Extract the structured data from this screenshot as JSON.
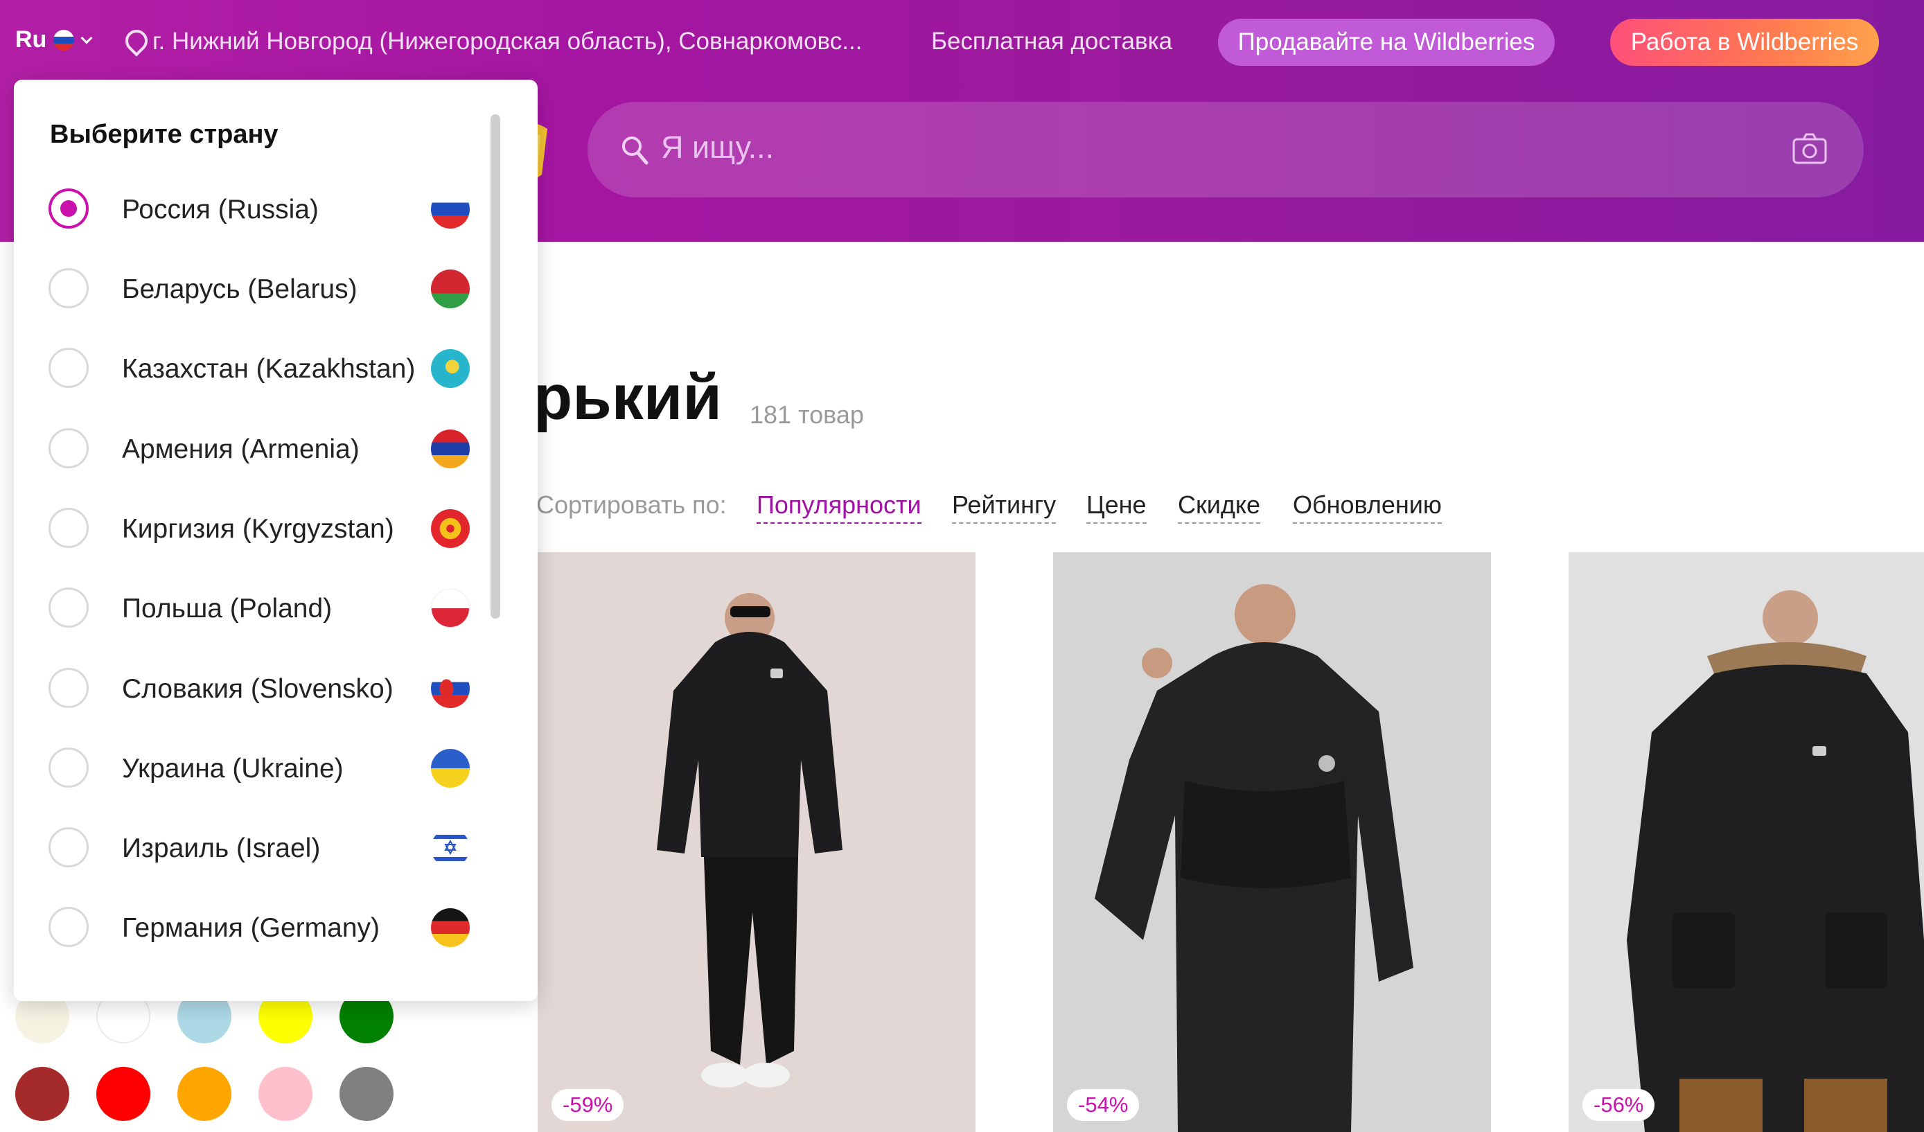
{
  "top_bar": {
    "lang": "Ru",
    "location": "г. Нижний Новгород (Нижегородская область), Совнаркомовс...",
    "delivery": "Бесплатная доставка",
    "sell_button": "Продавайте на Wildberries",
    "job_button": "Работа в Wildberries"
  },
  "search": {
    "placeholder": "Я ищу..."
  },
  "catalog": {
    "title": "рький",
    "count": "181 товар",
    "sort_label": "Сортировать по:",
    "sort_options": [
      "Популярности",
      "Рейтингу",
      "Цене",
      "Скидке",
      "Обновлению"
    ],
    "active_sort": "Популярности",
    "products": [
      {
        "discount": "-59%",
        "background": "#e2d7d4"
      },
      {
        "discount": "-54%",
        "background": "#d5d5d5"
      },
      {
        "discount": "-56%",
        "background": "#e0e0e0"
      }
    ]
  },
  "country_dropdown": {
    "title": "Выберите страну",
    "selected": "Россия (Russia)",
    "countries": [
      {
        "label": "Россия (Russia)",
        "flag": "russia-flag-icon"
      },
      {
        "label": "Беларусь (Belarus)",
        "flag": "belarus-flag-icon"
      },
      {
        "label": "Казахстан (Kazakhstan)",
        "flag": "kazakhstan-flag-icon"
      },
      {
        "label": "Армения (Armenia)",
        "flag": "armenia-flag-icon"
      },
      {
        "label": "Киргизия (Kyrgyzstan)",
        "flag": "kyrgyzstan-flag-icon"
      },
      {
        "label": "Польша (Poland)",
        "flag": "poland-flag-icon"
      },
      {
        "label": "Словакия (Slovensko)",
        "flag": "slovakia-flag-icon"
      },
      {
        "label": "Украина (Ukraine)",
        "flag": "ukraine-flag-icon"
      },
      {
        "label": "Израиль (Israel)",
        "flag": "israel-flag-icon"
      },
      {
        "label": "Германия (Germany)",
        "flag": "germany-flag-icon"
      }
    ]
  },
  "color_filters": [
    "#f6f3e3",
    "#ffffff",
    "#add8e6",
    "#ffff00",
    "#008000",
    "#a52a2a",
    "#ff0000",
    "#ffa500",
    "#ffc0cb",
    "#808080"
  ],
  "colors": {
    "brand": "#cb11ab",
    "header_start": "#b21fa6",
    "header_end": "#861ba0"
  }
}
